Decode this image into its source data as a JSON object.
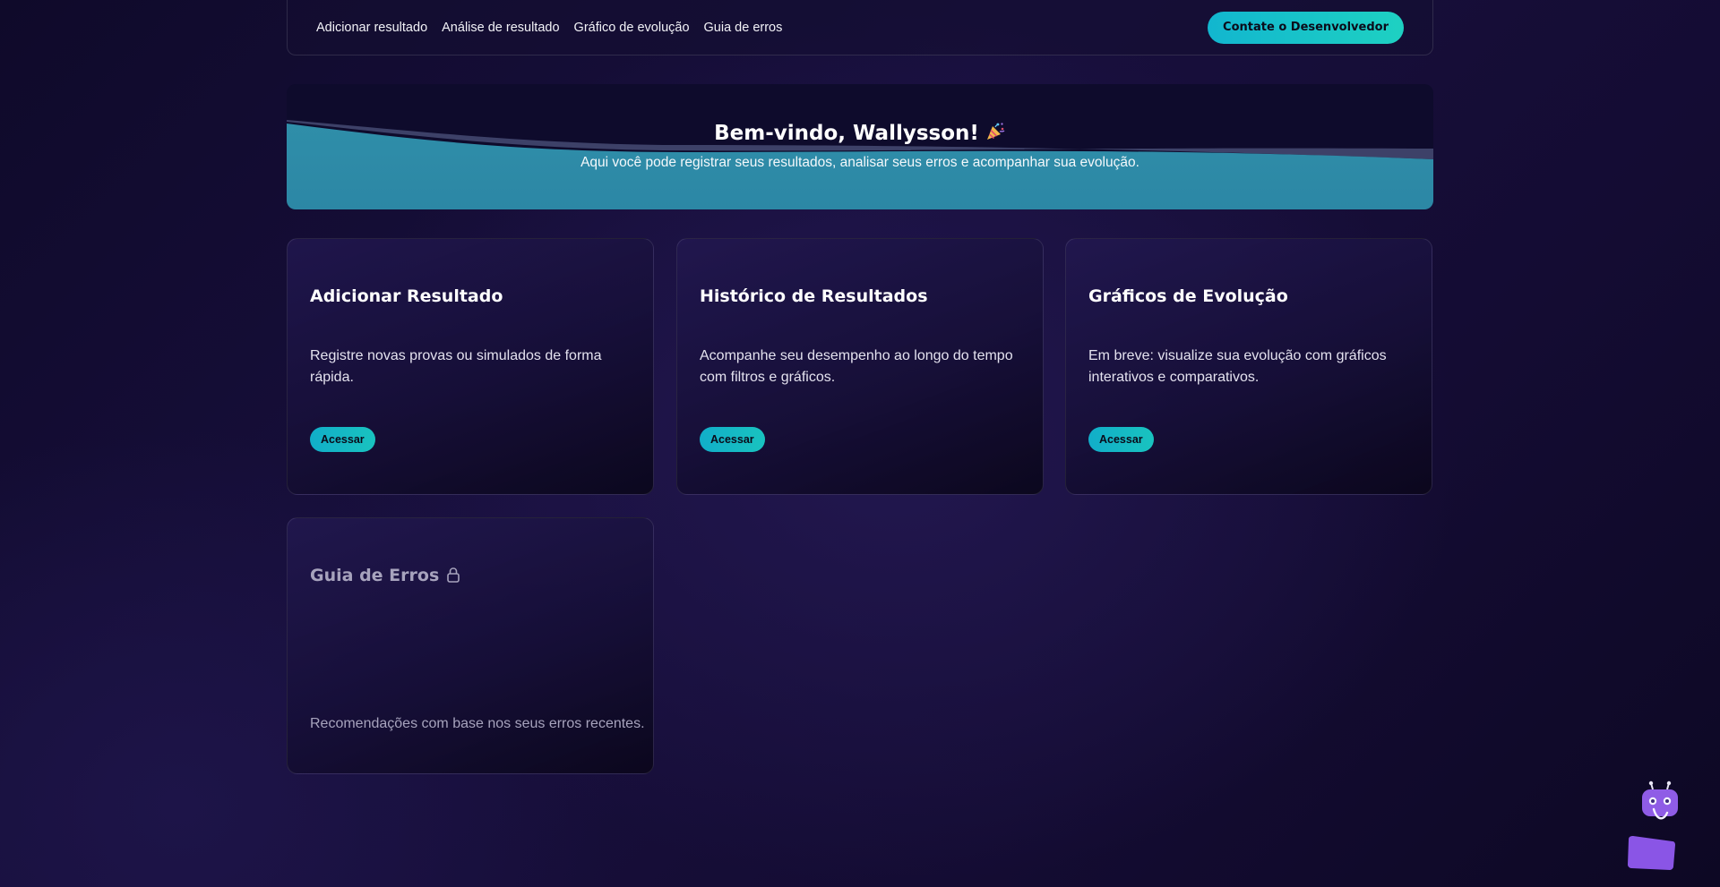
{
  "nav": {
    "links": [
      "Adicionar resultado",
      "Análise de resultado",
      "Gráfico de evolução",
      "Guia de erros"
    ],
    "contact_label": "Contate o Desenvolvedor"
  },
  "hero": {
    "title": "Bem-vindo, Wallysson!",
    "title_icon": "party-popper-icon",
    "subtitle": "Aqui você pode registrar seus resultados, analisar seus erros e acompanhar sua evolução."
  },
  "cards": [
    {
      "title": "Adicionar Resultado",
      "description": "Registre novas provas ou simulados de forma rápida.",
      "button": "Acessar"
    },
    {
      "title": "Histórico de Resultados",
      "description": "Acompanhe seu desempenho ao longo do tempo com filtros e gráficos.",
      "button": "Acessar"
    },
    {
      "title": "Gráficos de Evolução",
      "description": "Em breve: visualize sua evolução com gráficos interativos e comparativos.",
      "button": "Acessar"
    },
    {
      "title": "Guia de Erros",
      "description": "Recomendações com base nos seus erros recentes.",
      "locked": true,
      "icon": "lock-icon"
    }
  ],
  "assistant": {
    "icon": "robot-icon"
  },
  "colors": {
    "accent": "#1ec3c4",
    "background": "#150e38",
    "hero_wave": "#2e8ba8"
  }
}
